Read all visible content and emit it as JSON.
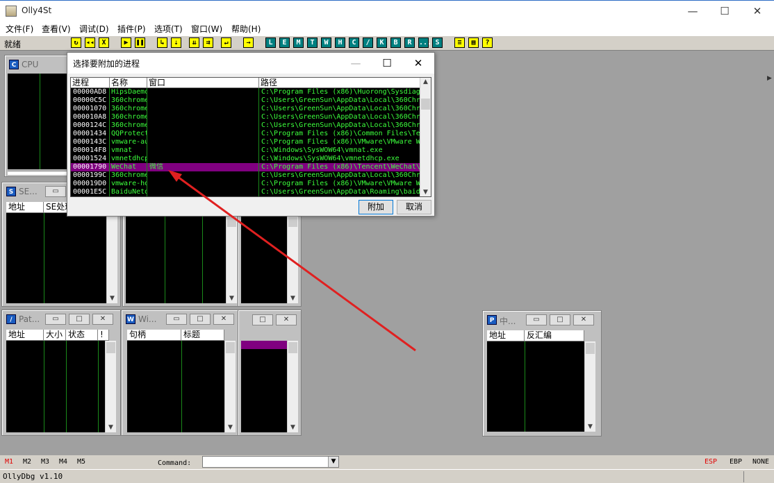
{
  "app": {
    "title": "Olly4St"
  },
  "window_controls": {
    "minimize": "—",
    "maximize": "☐",
    "close": "✕"
  },
  "menu": [
    "文件(F)",
    "查看(V)",
    "调试(D)",
    "插件(P)",
    "选项(T)",
    "窗口(W)",
    "帮助(H)"
  ],
  "toolbar": {
    "status": "就绪",
    "buttons": [
      "↻",
      "◂◂",
      "X",
      "▶",
      "❚❚",
      "↳",
      "⇣",
      "⇊",
      "⇉",
      "↵",
      "→",
      "L",
      "E",
      "M",
      "T",
      "W",
      "H",
      "C",
      "/",
      "K",
      "B",
      "R",
      "...",
      "S",
      "≡",
      "▦",
      "?"
    ]
  },
  "windows": {
    "cpu": {
      "title": "CPU",
      "icon": "C"
    },
    "seh": {
      "title": "SE...",
      "icon": "S",
      "headers": [
        "地址",
        "SE处理"
      ]
    },
    "patches": {
      "title": "Pat...",
      "icon": "/",
      "headers": [
        "地址",
        "大小",
        "状态",
        "!"
      ]
    },
    "windows_list": {
      "title": "Wi...",
      "icon": "W",
      "headers": [
        "句柄",
        "标题"
      ]
    },
    "references": {
      "title": "中...",
      "icon": "P",
      "headers": [
        "地址",
        "反汇编"
      ]
    }
  },
  "dialog": {
    "title": "选择要附加的进程",
    "headers": [
      "进程",
      "名称",
      "窗口",
      "路径"
    ],
    "rows": [
      {
        "pid": "00000AD8",
        "name": "HipsDaemo",
        "window": "",
        "path": "C:\\Program Files (x86)\\Huorong\\Sysdiag"
      },
      {
        "pid": "00000C5C",
        "name": "360chrome",
        "window": "",
        "path": "C:\\Users\\GreenSun\\AppData\\Local\\360Chro"
      },
      {
        "pid": "00001070",
        "name": "360chrome",
        "window": "",
        "path": "C:\\Users\\GreenSun\\AppData\\Local\\360Chro"
      },
      {
        "pid": "000010A8",
        "name": "360chrome",
        "window": "",
        "path": "C:\\Users\\GreenSun\\AppData\\Local\\360Chro"
      },
      {
        "pid": "0000124C",
        "name": "360chrome",
        "window": "",
        "path": "C:\\Users\\GreenSun\\AppData\\Local\\360Chro"
      },
      {
        "pid": "00001434",
        "name": "QQProtect",
        "window": "",
        "path": "C:\\Program Files (x86)\\Common Files\\Ten"
      },
      {
        "pid": "0000143C",
        "name": "vmware-au",
        "window": "",
        "path": "C:\\Program Files (x86)\\VMware\\VMware W"
      },
      {
        "pid": "000014F8",
        "name": "vmnat",
        "window": "",
        "path": "C:\\Windows\\SysWOW64\\vmnat.exe"
      },
      {
        "pid": "00001524",
        "name": "vmnetdhcp",
        "window": "",
        "path": "C:\\Windows\\SysWOW64\\vmnetdhcp.exe"
      },
      {
        "pid": "00001790",
        "name": "WeChat",
        "window": "微信",
        "path": "C:\\Program Files (x86)\\Tencent\\WeChat\\"
      },
      {
        "pid": "0000199C",
        "name": "360chrome",
        "window": "",
        "path": "C:\\Users\\GreenSun\\AppData\\Local\\360Chro"
      },
      {
        "pid": "000019D0",
        "name": "vmware-ho",
        "window": "",
        "path": "C:\\Program Files (x86)\\VMware\\VMware W"
      },
      {
        "pid": "00001E5C",
        "name": "BaiduNetd",
        "window": "",
        "path": "C:\\Users\\GreenSun\\AppData\\Roaming\\baid"
      }
    ],
    "selected_index": 9,
    "attach_button": "附加",
    "cancel_button": "取消"
  },
  "bottom": {
    "markers": [
      "M1",
      "M2",
      "M3",
      "M4",
      "M5"
    ],
    "command_label": "Command:",
    "command_value": "",
    "registers": [
      "ESP",
      "EBP",
      "NONE"
    ],
    "status_text": "OllyDbg v1.10"
  },
  "colors": {
    "highlight": "#800080",
    "list_text": "#3cff3c",
    "annotation_arrow": "#e02020",
    "active_marker": "#e00000"
  }
}
